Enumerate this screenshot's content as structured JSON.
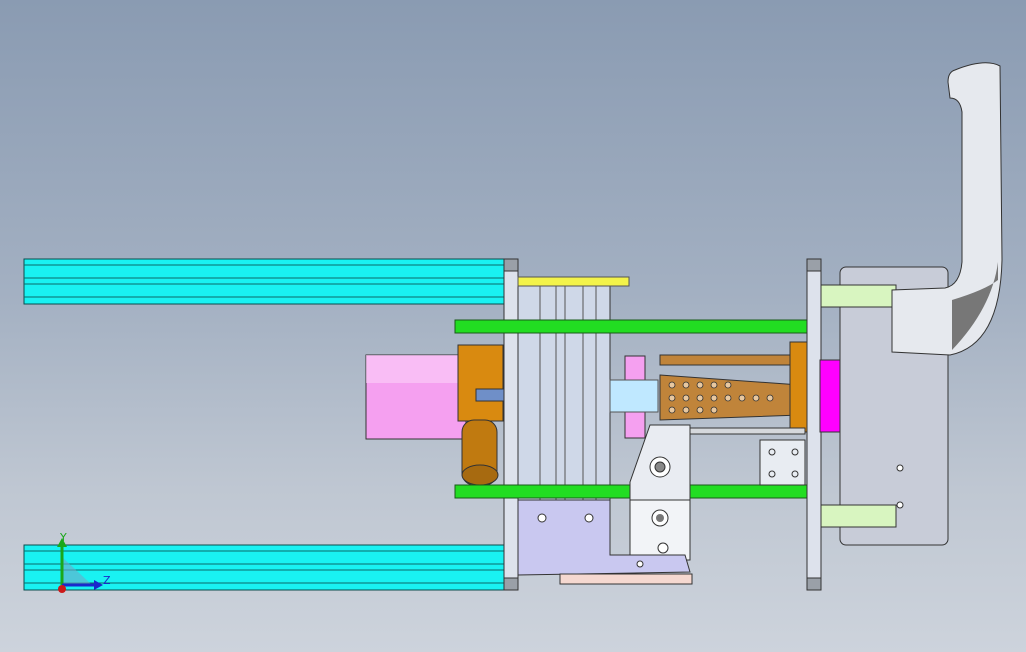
{
  "viewport": {
    "background_top": "#8a9bb2",
    "background_bottom": "#cdd3dc"
  },
  "triad": {
    "y_label": "Y",
    "z_label": "Z",
    "y_color": "#1aa81a",
    "z_color": "#1a2acc",
    "x_color": "#cc1a1a"
  },
  "model": {
    "colors": {
      "rail": "#19f2f2",
      "rod": "#22dd22",
      "cylinder": "#f5a0f0",
      "block": "#d98a10",
      "cone": "#c0843a",
      "plate": "#c8ccd8",
      "bracket": "#c9c8f0",
      "magenta": "#ff00ff",
      "light_green": "#d8f5c0",
      "yellow": "#f3f34a"
    }
  }
}
